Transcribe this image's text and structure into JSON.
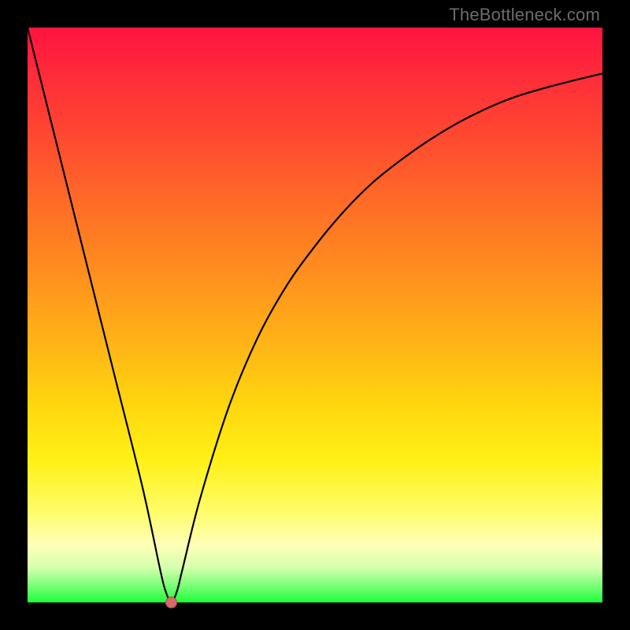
{
  "watermark": "TheBottleneck.com",
  "chart_data": {
    "type": "line",
    "title": "",
    "xlabel": "",
    "ylabel": "",
    "xlim": [
      0,
      100
    ],
    "ylim": [
      0,
      100
    ],
    "grid": false,
    "legend": false,
    "series": [
      {
        "name": "bottleneck-curve",
        "x": [
          0,
          5,
          10,
          15,
          20,
          23,
          24,
          25,
          26,
          27,
          30,
          35,
          40,
          45,
          50,
          55,
          60,
          65,
          70,
          75,
          80,
          85,
          90,
          95,
          100
        ],
        "values": [
          100,
          80,
          60,
          40,
          20,
          6,
          2,
          0,
          2,
          6,
          18,
          34,
          46,
          55,
          62,
          68,
          73,
          77,
          80.5,
          83.5,
          86,
          88,
          89.5,
          90.8,
          92
        ]
      }
    ],
    "annotations": [
      {
        "type": "marker",
        "shape": "circle",
        "x": 25,
        "y": 0,
        "color": "#d46a6a",
        "size": 8
      }
    ],
    "background": {
      "type": "vertical-gradient",
      "stops": [
        {
          "pos": 0.0,
          "color": "#ff133f"
        },
        {
          "pos": 0.3,
          "color": "#ff6a27"
        },
        {
          "pos": 0.65,
          "color": "#ffd40f"
        },
        {
          "pos": 0.9,
          "color": "#feffb8"
        },
        {
          "pos": 1.0,
          "color": "#1dff3a"
        }
      ]
    }
  }
}
